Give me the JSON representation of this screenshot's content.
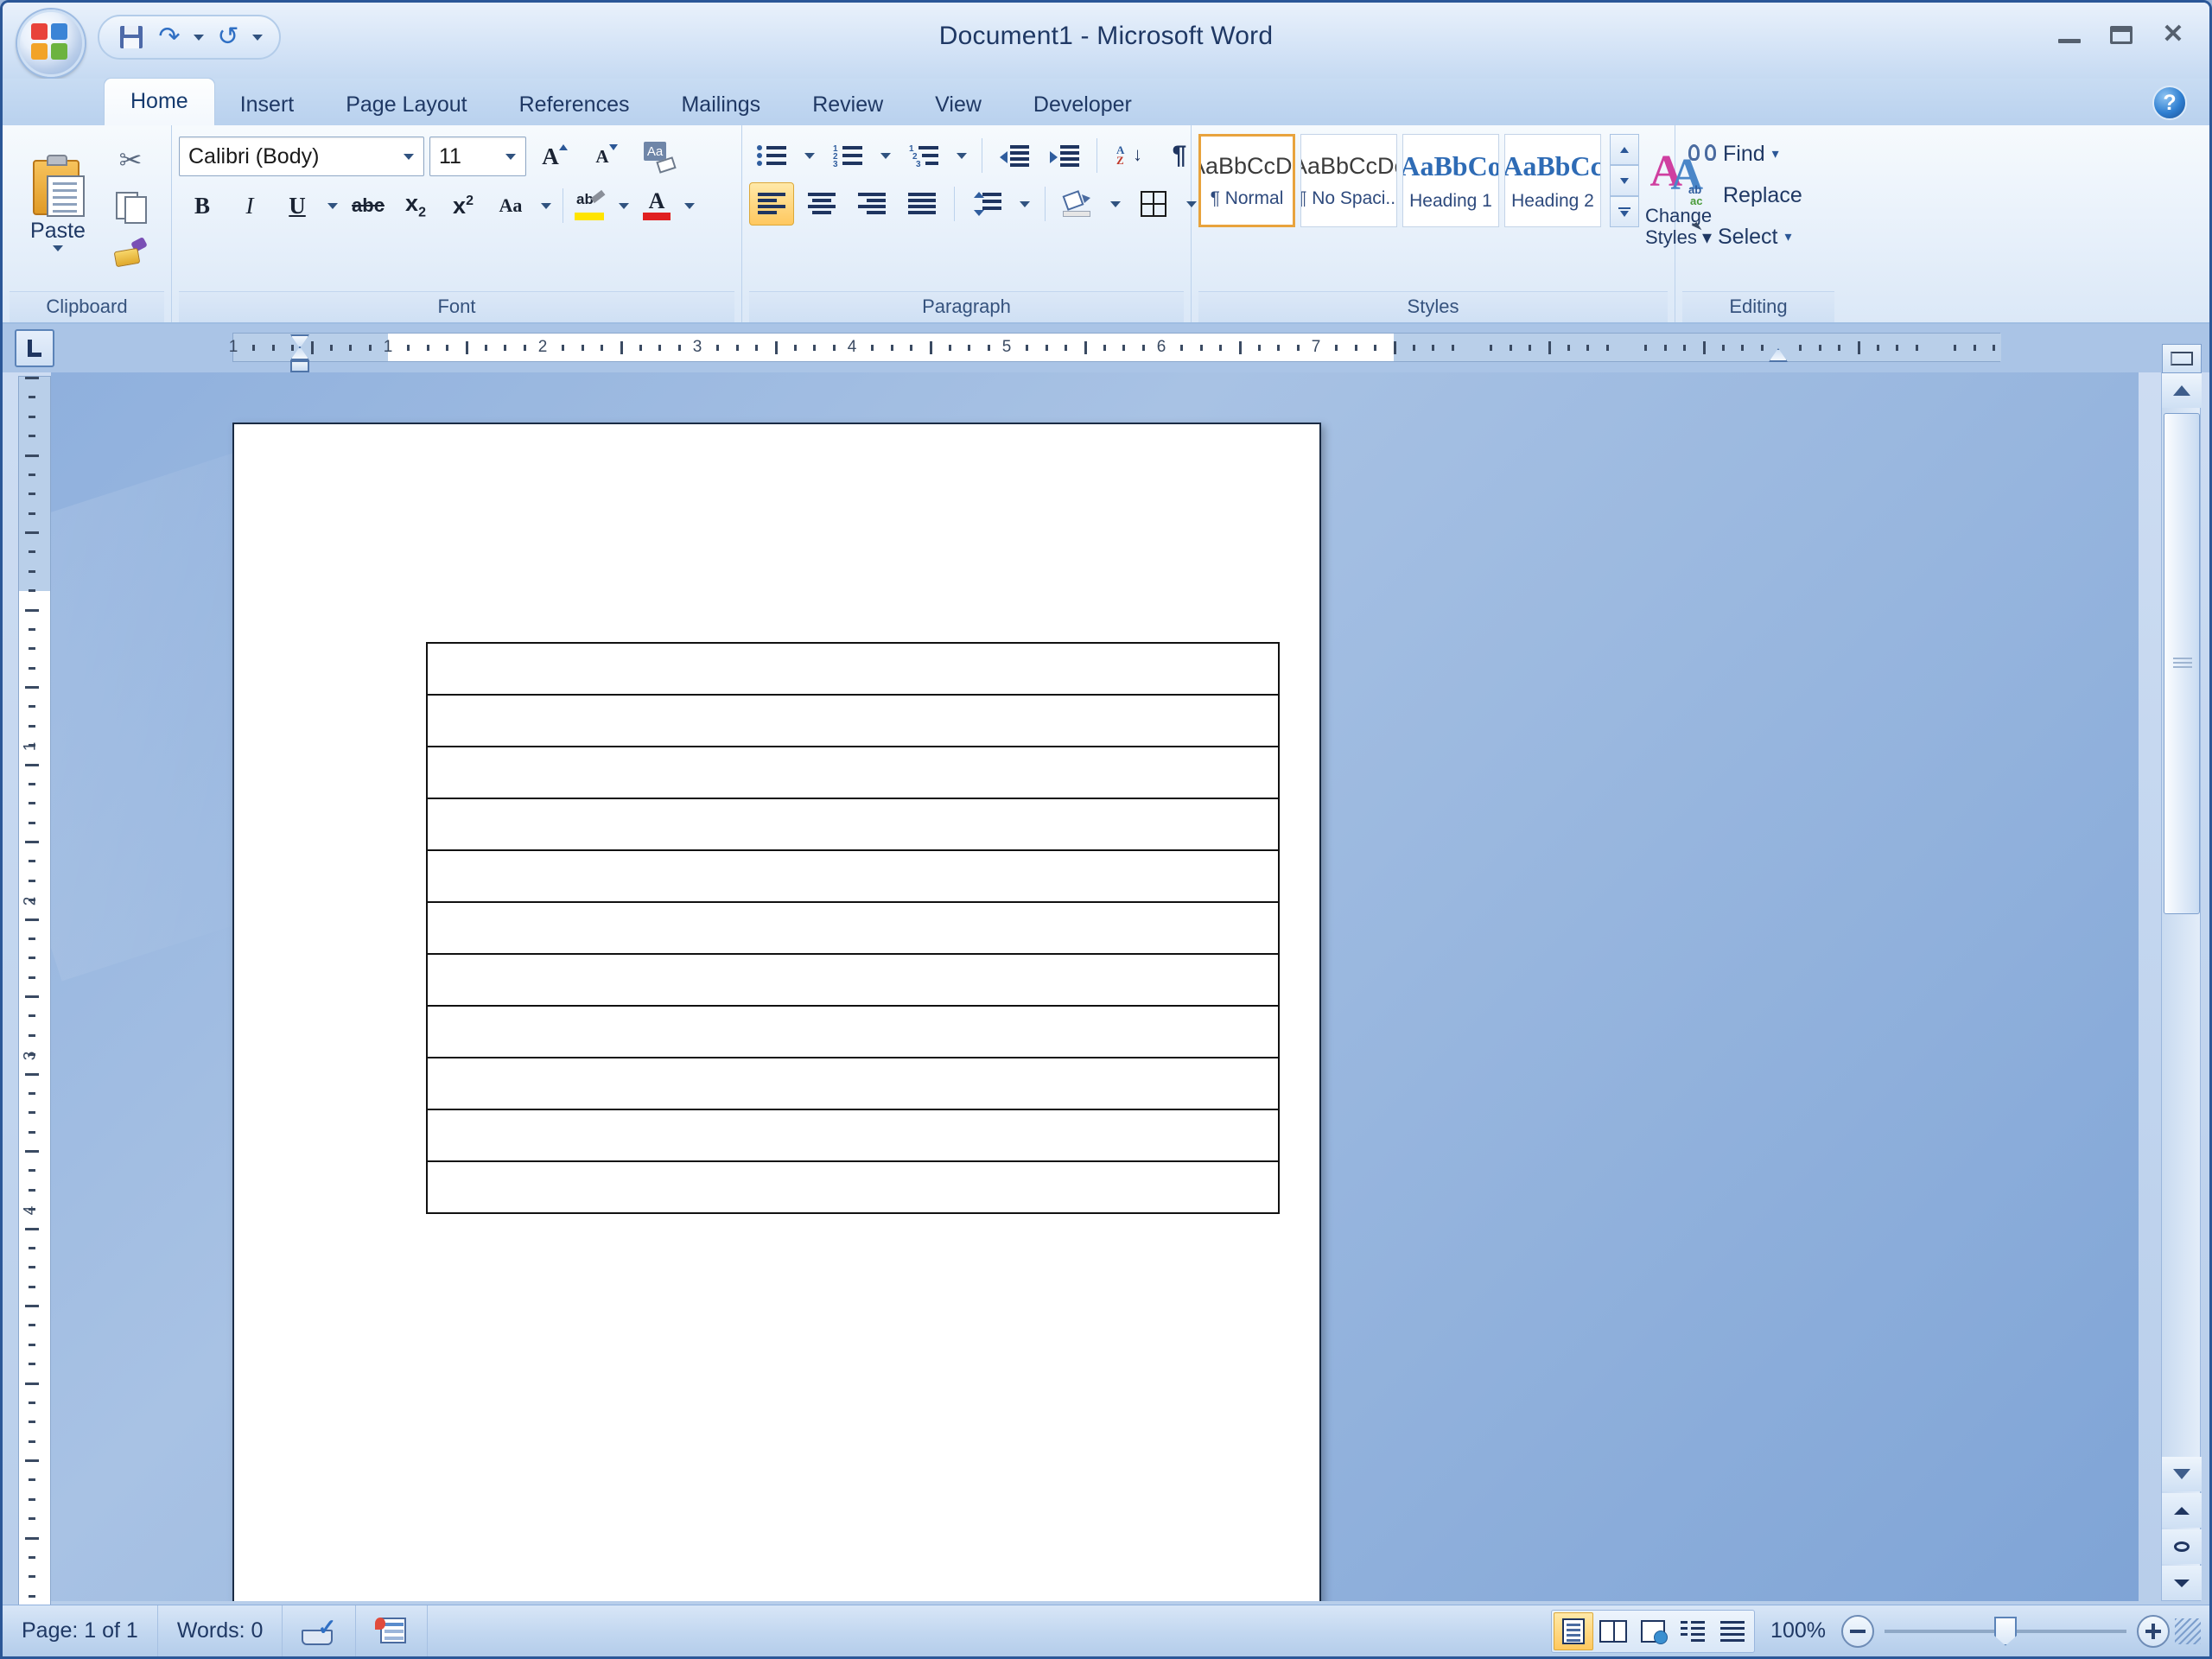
{
  "window": {
    "title": "Document1 - Microsoft Word",
    "minimize_label": "Minimize",
    "maximize_label": "Maximize",
    "close_label": "Close",
    "help_label": "?"
  },
  "office_button": {
    "label": "Office Button"
  },
  "quick_access_toolbar": {
    "items": [
      {
        "label": "Save",
        "icon": "save-icon"
      },
      {
        "label": "Undo",
        "icon": "undo-icon"
      },
      {
        "label": "Redo",
        "icon": "redo-icon"
      },
      {
        "label": "Customize Quick Access Toolbar",
        "icon": "chevron-down-icon"
      }
    ]
  },
  "tabs": [
    {
      "label": "Home",
      "active": true
    },
    {
      "label": "Insert",
      "active": false
    },
    {
      "label": "Page Layout",
      "active": false
    },
    {
      "label": "References",
      "active": false
    },
    {
      "label": "Mailings",
      "active": false
    },
    {
      "label": "Review",
      "active": false
    },
    {
      "label": "View",
      "active": false
    },
    {
      "label": "Developer",
      "active": false
    }
  ],
  "ribbon": {
    "clipboard": {
      "label": "Clipboard",
      "paste_label": "Paste",
      "cut_label": "Cut",
      "copy_label": "Copy",
      "format_painter_label": "Format Painter"
    },
    "font": {
      "label": "Font",
      "font_name": "Calibri (Body)",
      "font_size": "11",
      "grow_font_label": "Grow Font",
      "shrink_font_label": "Shrink Font",
      "clear_formatting_label": "Clear Formatting",
      "bold_label": "B",
      "italic_label": "I",
      "underline_label": "U",
      "strikethrough_label": "abc",
      "subscript_label": "x",
      "subscript_sub": "2",
      "superscript_label": "x",
      "superscript_sup": "2",
      "change_case_label": "Aa",
      "highlight_label": "Text Highlight Color",
      "highlight_color": "#ffe400",
      "font_color_label": "Font Color",
      "font_color": "#e02020"
    },
    "paragraph": {
      "label": "Paragraph",
      "bullets_label": "Bullets",
      "numbering_label": "Numbering",
      "multilevel_label": "Multilevel List",
      "decrease_indent_label": "Decrease Indent",
      "increase_indent_label": "Increase Indent",
      "sort_label": "Sort",
      "sort_top": "A",
      "sort_bottom": "Z",
      "show_marks_label": "¶",
      "align_left_label": "Align Text Left",
      "align_center_label": "Center",
      "align_right_label": "Align Text Right",
      "justify_label": "Justify",
      "line_spacing_label": "Line Spacing",
      "shading_label": "Shading",
      "borders_label": "Borders",
      "active_alignment": "Align Text Left"
    },
    "styles": {
      "label": "Styles",
      "gallery": [
        {
          "preview": "AaBbCcDc",
          "name": "¶ Normal",
          "id": "Normal",
          "selected": true
        },
        {
          "preview": "AaBbCcDc",
          "name": "¶ No Spaci...",
          "id": "No Spacing",
          "selected": false
        },
        {
          "preview": "AaBbCο",
          "name": "Heading 1",
          "id": "Heading 1",
          "selected": false
        },
        {
          "preview": "AaBbCc",
          "name": "Heading 2",
          "id": "Heading 2",
          "selected": false
        }
      ],
      "scroll_up_label": "Scroll Up",
      "scroll_down_label": "Scroll Down",
      "more_label": "More",
      "change_styles_line1": "Change",
      "change_styles_line2": "Styles"
    },
    "editing": {
      "label": "Editing",
      "find_label": "Find",
      "replace_label": "Replace",
      "select_label": "Select"
    }
  },
  "rulers": {
    "tab_selector_label": "Left Tab",
    "horizontal_numbers": [
      "1",
      "1",
      "2",
      "3",
      "4",
      "5",
      "6",
      "7"
    ],
    "vertical_numbers": [
      "1",
      "2",
      "3",
      "4"
    ],
    "left_margin_inches": 1,
    "right_indent_inches": 6.5,
    "first_line_indent_inches": 0
  },
  "document": {
    "table": {
      "columns": 1,
      "rows": 11,
      "cells": [
        [
          ""
        ],
        [
          ""
        ],
        [
          ""
        ],
        [
          ""
        ],
        [
          ""
        ],
        [
          ""
        ],
        [
          ""
        ],
        [
          ""
        ],
        [
          ""
        ],
        [
          ""
        ],
        [
          ""
        ]
      ],
      "border_color": "#111111"
    }
  },
  "scrollbar": {
    "split_label": "Split Window",
    "up_label": "Scroll Up",
    "down_label": "Scroll Down",
    "previous_page_label": "Previous Page",
    "select_browse_label": "Select Browse Object",
    "next_page_label": "Next Page"
  },
  "status_bar": {
    "page_text": "Page: 1 of 1",
    "words_text": "Words: 0",
    "spelling_label": "Spelling and Grammar Check",
    "language_label": "Macro Recording",
    "views": [
      {
        "label": "Print Layout",
        "icon": "print-layout-icon",
        "active": true
      },
      {
        "label": "Full Screen Reading",
        "icon": "full-screen-reading-icon",
        "active": false
      },
      {
        "label": "Web Layout",
        "icon": "web-layout-icon",
        "active": false
      },
      {
        "label": "Outline",
        "icon": "outline-icon",
        "active": false
      },
      {
        "label": "Draft",
        "icon": "draft-icon",
        "active": false
      }
    ],
    "zoom_level": "100%",
    "zoom_out_label": "Zoom Out",
    "zoom_in_label": "Zoom In",
    "zoom_slider_label": "Zoom Slider"
  },
  "colors": {
    "accent": "#2b5797",
    "title_text": "#1f3864",
    "selected_style_border": "#e8a33d",
    "active_highlight": "#ffc85f"
  }
}
